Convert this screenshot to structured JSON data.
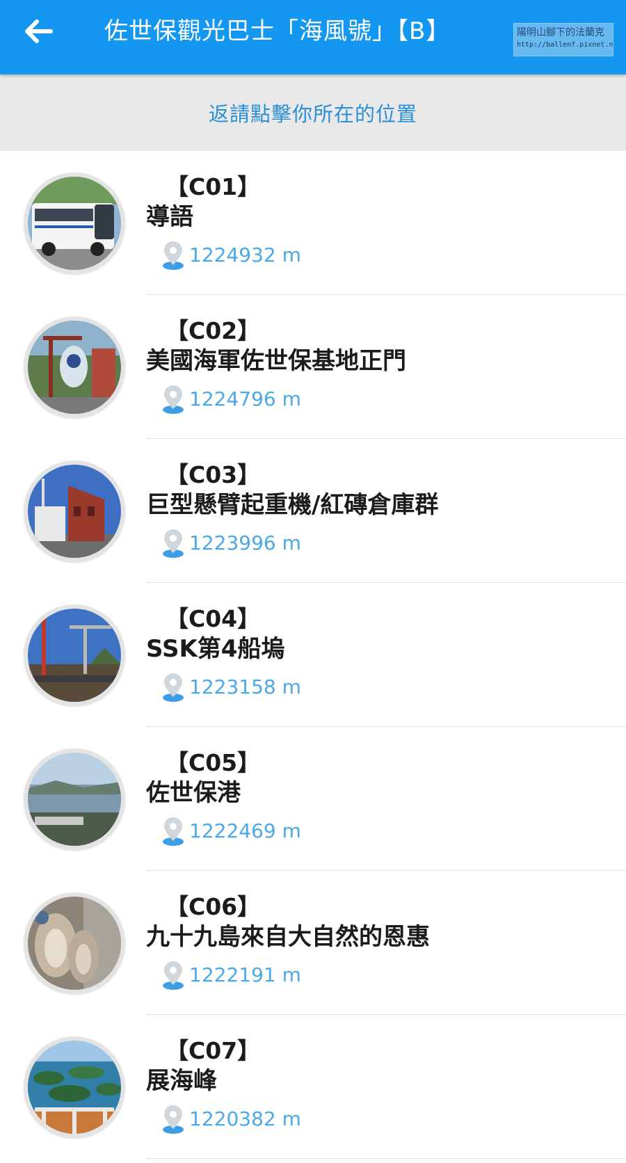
{
  "header": {
    "title": "佐世保觀光巴士「海風號」【B】",
    "watermark_name": "陽明山腳下的法蘭克",
    "watermark_url": "http://ballenf.pixnet.net/blog"
  },
  "location_bar": {
    "label": "返請點擊你所在的位置"
  },
  "stops": [
    {
      "code": "【C01】",
      "name": "導語",
      "distance": "1224932 m",
      "icon": "bus-photo"
    },
    {
      "code": "【C02】",
      "name": "美國海軍佐世保基地正門",
      "distance": "1224796 m",
      "icon": "navy-gate-photo"
    },
    {
      "code": "【C03】",
      "name": "巨型懸臂起重機/紅磚倉庫群",
      "distance": "1223996 m",
      "icon": "crane-warehouse-photo"
    },
    {
      "code": "【C04】",
      "name": "SSK第4船塢",
      "distance": "1223158 m",
      "icon": "shipyard-photo"
    },
    {
      "code": "【C05】",
      "name": "佐世保港",
      "distance": "1222469 m",
      "icon": "harbor-photo"
    },
    {
      "code": "【C06】",
      "name": "九十九島來自大自然的恩惠",
      "distance": "1222191 m",
      "icon": "oysters-photo"
    },
    {
      "code": "【C07】",
      "name": "展海峰",
      "distance": "1220382 m",
      "icon": "islands-view-photo"
    }
  ],
  "colors": {
    "header_bg": "#1397f0",
    "location_bar_bg": "#e9e9e9",
    "link_blue": "#2a8fd6",
    "distance_blue": "#4aa8e8"
  }
}
